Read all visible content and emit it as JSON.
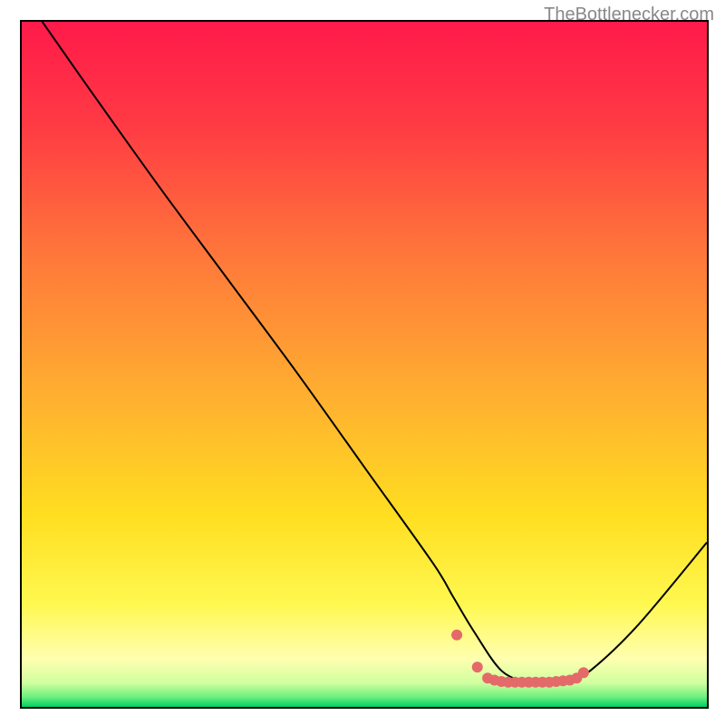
{
  "watermark": "TheBottlenecker.com",
  "chart_data": {
    "type": "line",
    "title": "",
    "xlabel": "",
    "ylabel": "",
    "xlim": [
      0,
      100
    ],
    "ylim": [
      0,
      100
    ],
    "series": [
      {
        "name": "curve",
        "color": "#000000",
        "stroke_width": 2,
        "x": [
          3,
          10,
          20,
          30,
          40,
          50,
          60,
          63,
          66,
          70,
          74,
          78,
          80,
          83,
          90,
          100
        ],
        "y": [
          100,
          90,
          76,
          62.5,
          49,
          35,
          21,
          16,
          11,
          5.3,
          3.6,
          3.6,
          3.9,
          5.3,
          12,
          24
        ]
      },
      {
        "name": "markers",
        "color": "#e46a6a",
        "type": "scatter",
        "marker_size": 6,
        "x": [
          63.5,
          66.5,
          68,
          69,
          70,
          71,
          72,
          73,
          74,
          75,
          76,
          77,
          78,
          79,
          80,
          81,
          82
        ],
        "y": [
          10.5,
          5.8,
          4.2,
          3.9,
          3.7,
          3.6,
          3.6,
          3.6,
          3.6,
          3.6,
          3.6,
          3.6,
          3.7,
          3.8,
          3.9,
          4.2,
          5.0
        ]
      }
    ],
    "background_gradient": {
      "stops": [
        {
          "offset": 0.0,
          "color": "#ff1a4a"
        },
        {
          "offset": 0.15,
          "color": "#ff3a44"
        },
        {
          "offset": 0.35,
          "color": "#ff7a3a"
        },
        {
          "offset": 0.55,
          "color": "#ffb030"
        },
        {
          "offset": 0.72,
          "color": "#ffde20"
        },
        {
          "offset": 0.85,
          "color": "#fff850"
        },
        {
          "offset": 0.93,
          "color": "#ffffb0"
        },
        {
          "offset": 0.965,
          "color": "#d0ffa0"
        },
        {
          "offset": 0.985,
          "color": "#70f080"
        },
        {
          "offset": 1.0,
          "color": "#00d060"
        }
      ]
    }
  }
}
